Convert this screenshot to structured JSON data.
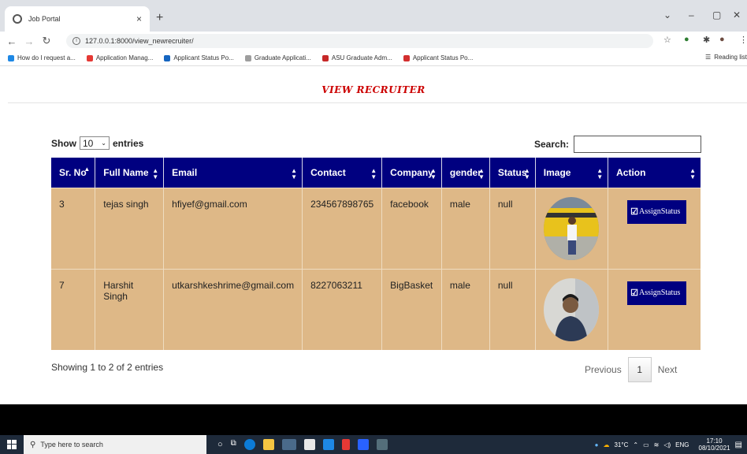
{
  "browser": {
    "tab_title": "Job Portal",
    "tab_close": "×",
    "new_tab": "+",
    "url": "127.0.0.1:8000/view_newrecruiter/",
    "bookmarks": [
      {
        "label": "How do I request a...",
        "color": "#1e88e5"
      },
      {
        "label": "Application Manag...",
        "color": "#e53935"
      },
      {
        "label": "Applicant Status Po...",
        "color": "#1565c0"
      },
      {
        "label": "Graduate Applicati...",
        "color": "#9e9e9e"
      },
      {
        "label": "ASU Graduate Adm...",
        "color": "#c62828"
      },
      {
        "label": "Applicant Status Po...",
        "color": "#d32f2f"
      }
    ],
    "reading_list": "Reading list"
  },
  "page": {
    "title": "VIEW RECRUITER",
    "length": {
      "show": "Show",
      "value": "10",
      "entries": "entries"
    },
    "search_label": "Search:",
    "search_value": "",
    "columns": [
      "Sr. No",
      "Full Name",
      "Email",
      "Contact",
      "Company",
      "gender",
      "Status",
      "Image",
      "Action"
    ],
    "rows": [
      {
        "sr": "3",
        "name": "tejas singh",
        "email": "hfiyef@gmail.com",
        "contact": "234567898765",
        "company": "facebook",
        "gender": "male",
        "status": "null",
        "action": "AssignStatus"
      },
      {
        "sr": "7",
        "name": "Harshit Singh",
        "email": "utkarshkeshrime@gmail.com",
        "contact": "8227063211",
        "company": "BigBasket",
        "gender": "male",
        "status": "null",
        "action": "AssignStatus"
      }
    ],
    "info": "Showing 1 to 2 of 2 entries",
    "pager": {
      "previous": "Previous",
      "current": "1",
      "next": "Next"
    }
  },
  "taskbar": {
    "search_placeholder": "Type here to search",
    "temperature": "31°C",
    "language": "ENG",
    "time": "17:10",
    "date": "08/10/2021"
  },
  "colors": {
    "header": "#000080",
    "row": "#deb887",
    "title": "#cc0000"
  }
}
